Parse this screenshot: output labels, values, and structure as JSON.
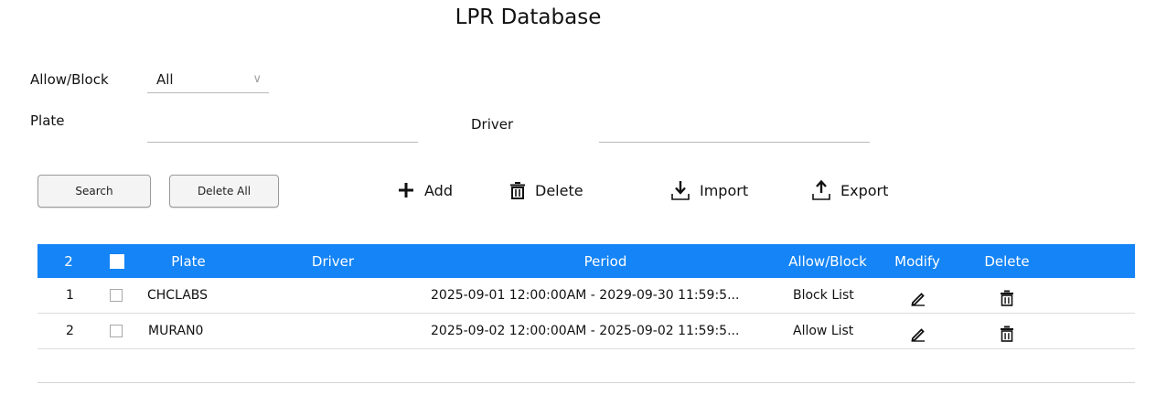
{
  "title": "LPR Database",
  "filters": {
    "allow_block_label": "Allow/Block",
    "allow_block_value": "All",
    "plate_label": "Plate",
    "plate_value": "",
    "driver_label": "Driver",
    "driver_value": ""
  },
  "buttons": {
    "search": "Search",
    "delete_all": "Delete All"
  },
  "toolbar": {
    "add": "Add",
    "delete": "Delete",
    "import": "Import",
    "export": "Export"
  },
  "table": {
    "headers": {
      "index": "2",
      "plate": "Plate",
      "driver": "Driver",
      "period": "Period",
      "allow_block": "Allow/Block",
      "modify": "Modify",
      "delete": "Delete"
    },
    "rows": [
      {
        "index": "1",
        "plate": "CHCLABS",
        "driver": "",
        "period": "2025-09-01 12:00:00AM - 2029-09-30 11:59:5...",
        "allow_block": "Block List"
      },
      {
        "index": "2",
        "plate": "MURAN0",
        "driver": "",
        "period": "2025-09-02 12:00:00AM - 2025-09-02 11:59:5...",
        "allow_block": "Allow List"
      }
    ]
  },
  "colors": {
    "header_bg": "#1484f6",
    "header_text": "#ffffff"
  },
  "icons": {
    "add": "plus-icon",
    "delete": "trash-icon",
    "import": "download-icon",
    "export": "upload-icon",
    "modify": "pencil-icon",
    "row_delete": "trash-icon",
    "dropdown": "chevron-down-icon"
  }
}
